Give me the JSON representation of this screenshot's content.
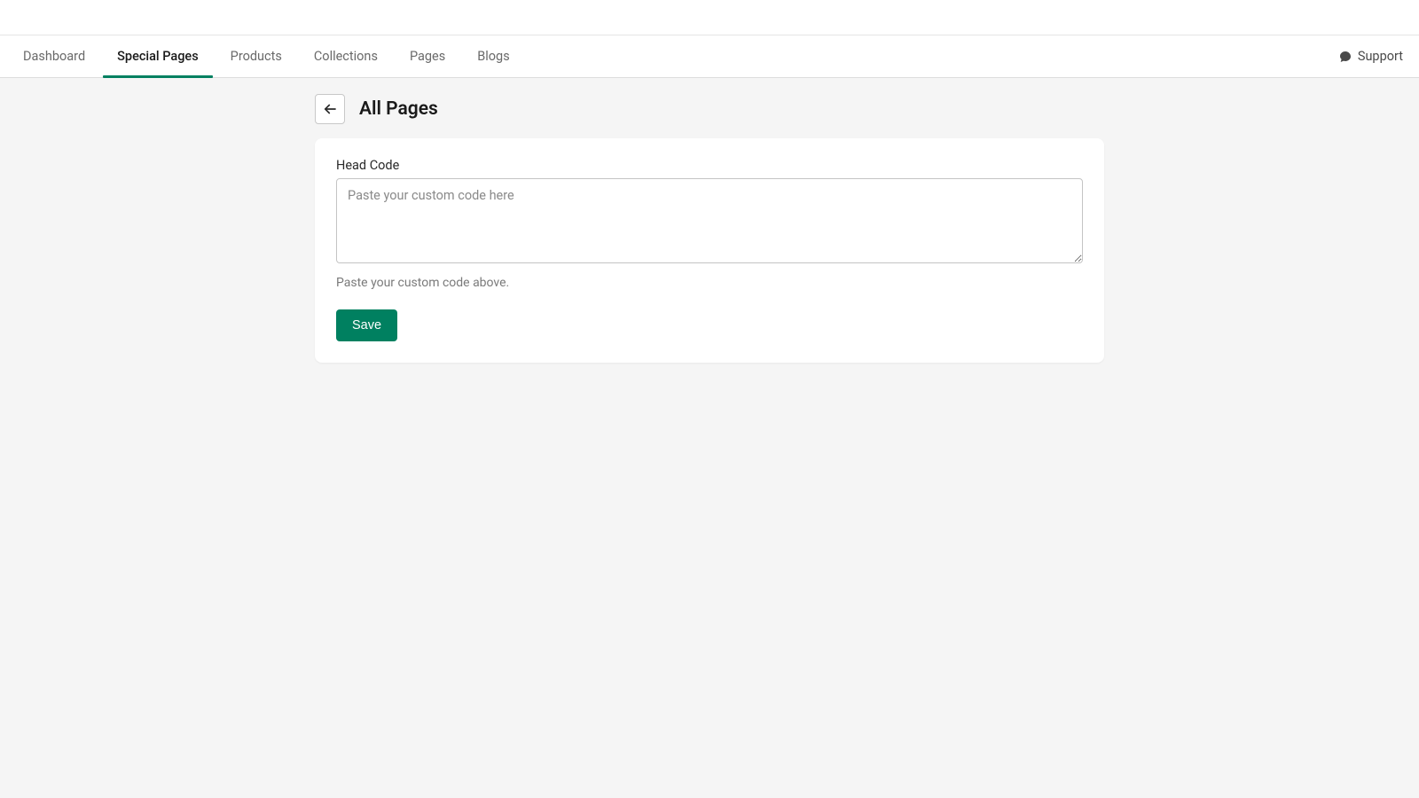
{
  "nav": {
    "tabs": [
      {
        "label": "Dashboard",
        "active": false
      },
      {
        "label": "Special Pages",
        "active": true
      },
      {
        "label": "Products",
        "active": false
      },
      {
        "label": "Collections",
        "active": false
      },
      {
        "label": "Pages",
        "active": false
      },
      {
        "label": "Blogs",
        "active": false
      }
    ],
    "support_label": "Support"
  },
  "header": {
    "title": "All Pages"
  },
  "form": {
    "head_code_label": "Head Code",
    "head_code_placeholder": "Paste your custom code here",
    "head_code_value": "",
    "helper_text": "Paste your custom code above.",
    "save_label": "Save"
  },
  "colors": {
    "accent": "#008060"
  }
}
